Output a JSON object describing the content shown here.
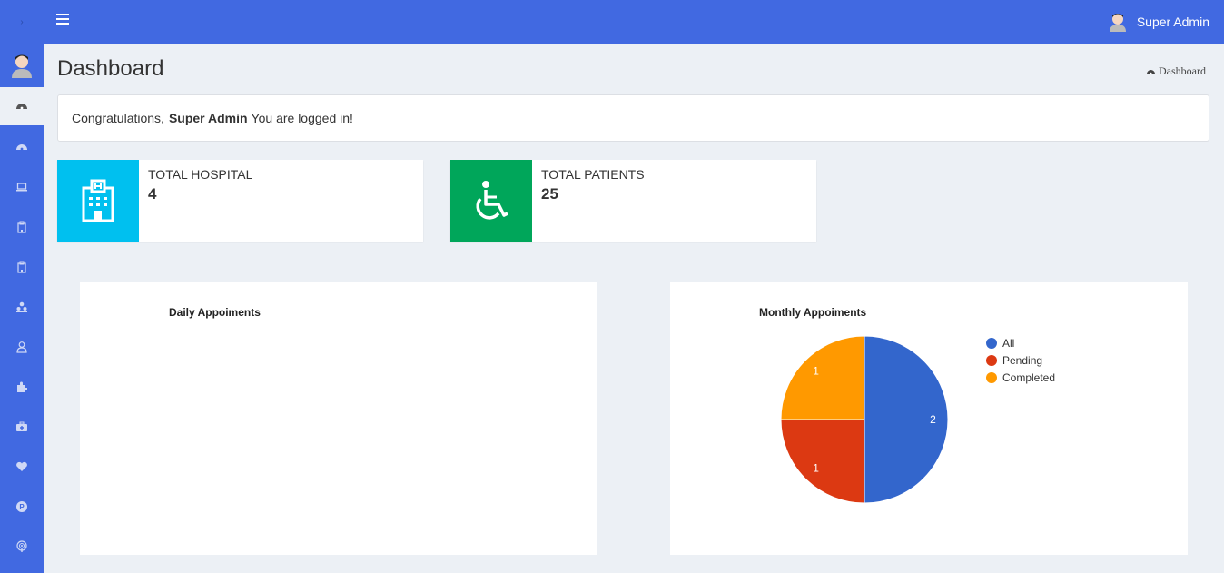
{
  "header": {
    "menu_icon": "hamburger-icon",
    "user_name": "Super Admin",
    "user_icon": "user-avatar-icon"
  },
  "sidebar": {
    "items": [
      {
        "icon": "dashboard-icon"
      },
      {
        "icon": "dashboard-icon"
      },
      {
        "icon": "laptop-icon"
      },
      {
        "icon": "hospital-icon"
      },
      {
        "icon": "hospital-icon"
      },
      {
        "icon": "users-icon"
      },
      {
        "icon": "user-icon"
      },
      {
        "icon": "puzzle-icon"
      },
      {
        "icon": "medkit-icon"
      },
      {
        "icon": "heart-icon"
      },
      {
        "icon": "parking-icon"
      },
      {
        "icon": "podcast-icon"
      }
    ]
  },
  "page": {
    "title": "Dashboard",
    "breadcrumb": "Dashboard"
  },
  "alert": {
    "prefix": "Congratulations,",
    "name": "Super Admin",
    "suffix": "You are logged in!"
  },
  "stats": [
    {
      "label": "TOTAL HOSPITAL",
      "value": "4",
      "color": "#00c0ef",
      "icon": "hospital-icon"
    },
    {
      "label": "TOTAL PATIENTS",
      "value": "25",
      "color": "#00a65a",
      "icon": "wheelchair-icon"
    }
  ],
  "panels": {
    "daily_title": "Daily Appoiments",
    "monthly_title": "Monthly Appoiments"
  },
  "chart_data": {
    "type": "pie",
    "title": "Monthly Appoiments",
    "categories": [
      "All",
      "Pending",
      "Completed"
    ],
    "values": [
      2,
      1,
      1
    ],
    "colors": [
      "#3366cc",
      "#dc3912",
      "#ff9900"
    ],
    "legend": "right"
  }
}
